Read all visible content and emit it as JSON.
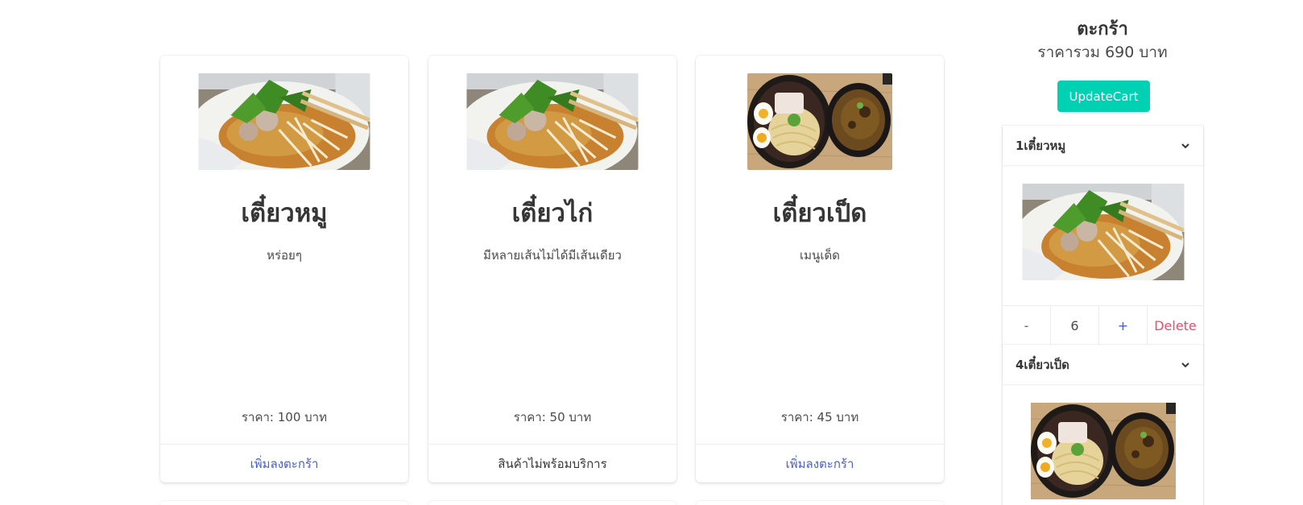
{
  "products": [
    {
      "title": "เตี๋ยวหมู",
      "desc": "หร่อยๆ",
      "price": "ราคา: 100 บาท",
      "action": "เพิ่มลงตะกร้า",
      "image": "boat-noodle-photo"
    },
    {
      "title": "เตี๋ยวไก่",
      "desc": "มีหลายเส้นไม่ได้มีเส้นเดียว",
      "price": "ราคา: 50 บาท",
      "action": "สินค้าไม่พร้อมบริการ",
      "image": "boat-noodle-photo"
    },
    {
      "title": "เตี๋ยวเป็ด",
      "desc": "เมนูเด็ด",
      "price": "ราคา: 45 บาท",
      "action": "เพิ่มลงตะกร้า",
      "image": "tsukemen-photo"
    }
  ],
  "cart": {
    "title": "ตะกร้า",
    "total": "ราคารวม 690 บาท",
    "update_label": "UpdateCart",
    "items": [
      {
        "header": "1เตี๋ยวหมู",
        "minus": "-",
        "qty": "6",
        "plus": "+",
        "delete": "Delete",
        "image": "boat-noodle-photo"
      },
      {
        "header": "4เตี๋ยวเป็ด",
        "image": "tsukemen-photo"
      }
    ]
  },
  "colors": {
    "primary_button": "#00d1b2",
    "link": "#485fc7",
    "danger": "#f14668",
    "text": "#363636"
  },
  "icons": {
    "panel_toggle": "chevron-down-icon"
  }
}
